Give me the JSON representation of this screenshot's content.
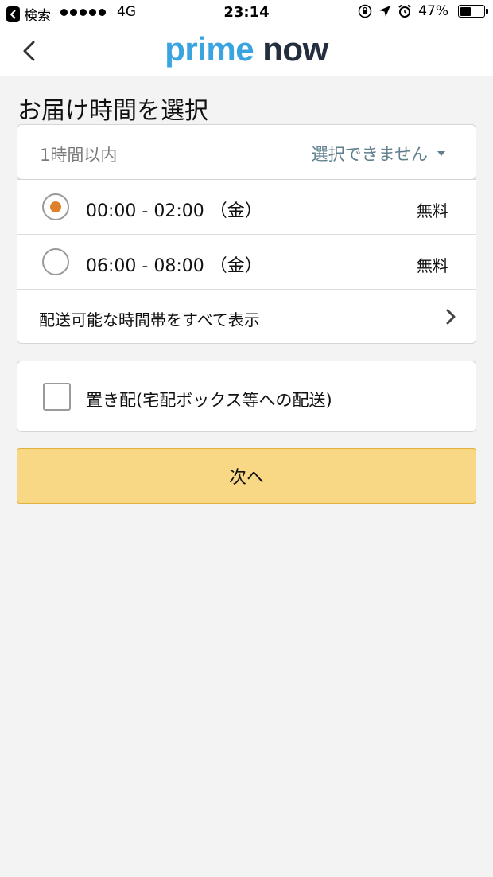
{
  "status_bar": {
    "back_app_label": "検索",
    "network": "4G",
    "time": "23:14",
    "battery_text": "47%",
    "battery_level": 0.47
  },
  "nav": {
    "logo_prime": "prime",
    "logo_now": "now"
  },
  "page_title": "お届け時間を選択",
  "slot_header": {
    "label": "1時間以内",
    "dropdown_value": "選択できません"
  },
  "slots": [
    {
      "time": "00:00 - 02:00 （金）",
      "price": "無料",
      "selected": true
    },
    {
      "time": "06:00 - 08:00 （金）",
      "price": "無料",
      "selected": false
    }
  ],
  "show_all_label": "配送可能な時間帯をすべて表示",
  "leave_at_door": {
    "label": "置き配(宅配ボックス等への配送)",
    "checked": false
  },
  "next_button_label": "次へ",
  "colors": {
    "accent_orange": "#e0802b",
    "logo_blue": "#3aa4e0",
    "logo_dark": "#232f3e",
    "button_yellow": "#f8d785",
    "dropdown_teal": "#5f7f8c"
  }
}
